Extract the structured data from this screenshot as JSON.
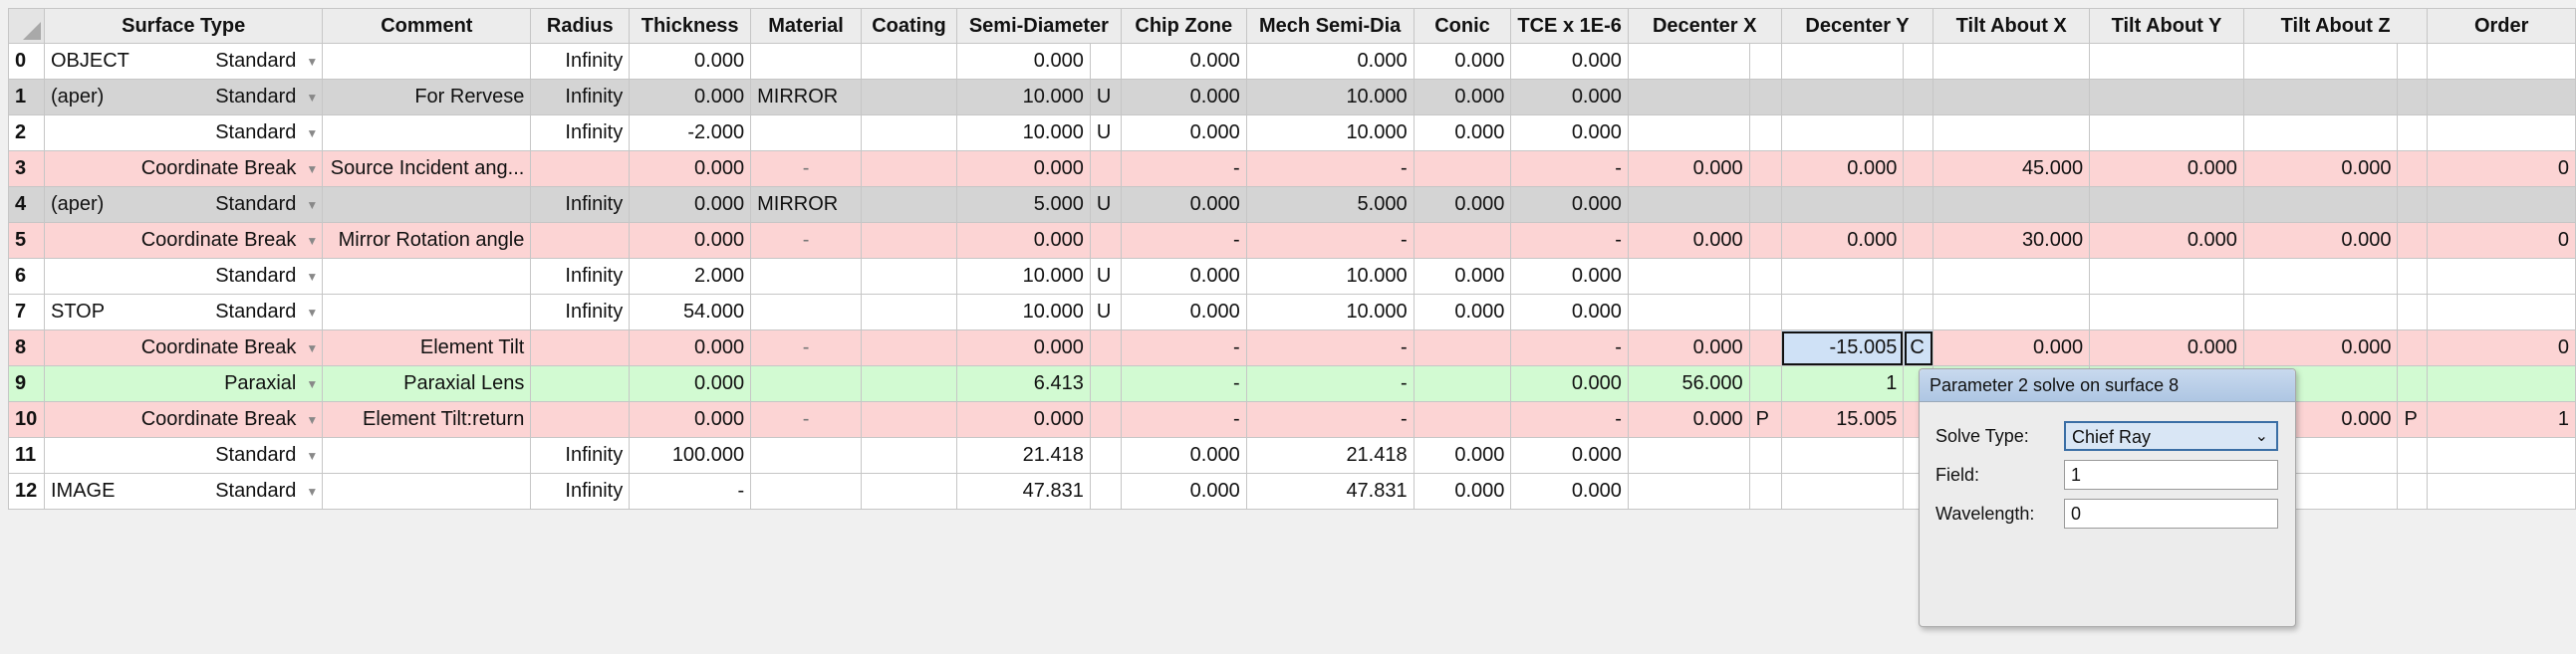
{
  "columns": [
    "Surface Type",
    "Comment",
    "Radius",
    "Thickness",
    "Material",
    "Coating",
    "Semi-Diameter",
    "Chip Zone",
    "Mech Semi-Dia",
    "Conic",
    "TCE x 1E-6",
    "Decenter X",
    "Decenter Y",
    "Tilt About X",
    "Tilt About Y",
    "Tilt About Z",
    "Order"
  ],
  "rows": [
    {
      "num": "0",
      "style": "std",
      "prefix": "OBJECT",
      "type": "Standard",
      "comment": "",
      "radius": "Infinity",
      "thickness": "0.000",
      "material": "",
      "coating": "",
      "semi": "0.000",
      "semi_flag": "",
      "chip": "0.000",
      "mech": "0.000",
      "conic": "0.000",
      "tce": "0.000",
      "dx": "",
      "dx_flag": "",
      "dy": "",
      "dy_flag": "",
      "tx": "",
      "ty": "",
      "tz": "",
      "tz_flag": "",
      "order": ""
    },
    {
      "num": "1",
      "style": "grey",
      "prefix": "(aper)",
      "type": "Standard",
      "comment": "For Rervese",
      "radius": "Infinity",
      "thickness": "0.000",
      "material": "MIRROR",
      "coating": "",
      "semi": "10.000",
      "semi_flag": "U",
      "chip": "0.000",
      "mech": "10.000",
      "conic": "0.000",
      "tce": "0.000",
      "dx": "",
      "dx_flag": "",
      "dy": "",
      "dy_flag": "",
      "tx": "",
      "ty": "",
      "tz": "",
      "tz_flag": "",
      "order": ""
    },
    {
      "num": "2",
      "style": "std",
      "prefix": "",
      "type": "Standard",
      "comment": "",
      "radius": "Infinity",
      "thickness": "-2.000",
      "material": "",
      "coating": "",
      "semi": "10.000",
      "semi_flag": "U",
      "chip": "0.000",
      "mech": "10.000",
      "conic": "0.000",
      "tce": "0.000",
      "dx": "",
      "dx_flag": "",
      "dy": "",
      "dy_flag": "",
      "tx": "",
      "ty": "",
      "tz": "",
      "tz_flag": "",
      "order": ""
    },
    {
      "num": "3",
      "style": "pink",
      "prefix": "",
      "type": "Coordinate Break",
      "comment": "Source Incident ang...",
      "radius": "",
      "thickness": "0.000",
      "material": "-",
      "coating": "",
      "semi": "0.000",
      "semi_flag": "",
      "chip": "-",
      "mech": "-",
      "conic": "",
      "tce": "-",
      "dx": "0.000",
      "dx_flag": "",
      "dy": "0.000",
      "dy_flag": "",
      "tx": "45.000",
      "ty": "0.000",
      "tz": "0.000",
      "tz_flag": "",
      "order": "0"
    },
    {
      "num": "4",
      "style": "grey",
      "prefix": "(aper)",
      "type": "Standard",
      "comment": "",
      "radius": "Infinity",
      "thickness": "0.000",
      "material": "MIRROR",
      "coating": "",
      "semi": "5.000",
      "semi_flag": "U",
      "chip": "0.000",
      "mech": "5.000",
      "conic": "0.000",
      "tce": "0.000",
      "dx": "",
      "dx_flag": "",
      "dy": "",
      "dy_flag": "",
      "tx": "",
      "ty": "",
      "tz": "",
      "tz_flag": "",
      "order": ""
    },
    {
      "num": "5",
      "style": "pink",
      "prefix": "",
      "type": "Coordinate Break",
      "comment": "Mirror Rotation angle",
      "radius": "",
      "thickness": "0.000",
      "material": "-",
      "coating": "",
      "semi": "0.000",
      "semi_flag": "",
      "chip": "-",
      "mech": "-",
      "conic": "",
      "tce": "-",
      "dx": "0.000",
      "dx_flag": "",
      "dy": "0.000",
      "dy_flag": "",
      "tx": "30.000",
      "ty": "0.000",
      "tz": "0.000",
      "tz_flag": "",
      "order": "0"
    },
    {
      "num": "6",
      "style": "std",
      "prefix": "",
      "type": "Standard",
      "comment": "",
      "radius": "Infinity",
      "thickness": "2.000",
      "material": "",
      "coating": "",
      "semi": "10.000",
      "semi_flag": "U",
      "chip": "0.000",
      "mech": "10.000",
      "conic": "0.000",
      "tce": "0.000",
      "dx": "",
      "dx_flag": "",
      "dy": "",
      "dy_flag": "",
      "tx": "",
      "ty": "",
      "tz": "",
      "tz_flag": "",
      "order": ""
    },
    {
      "num": "7",
      "style": "std",
      "prefix": "STOP",
      "type": "Standard",
      "comment": "",
      "radius": "Infinity",
      "thickness": "54.000",
      "material": "",
      "coating": "",
      "semi": "10.000",
      "semi_flag": "U",
      "chip": "0.000",
      "mech": "10.000",
      "conic": "0.000",
      "tce": "0.000",
      "dx": "",
      "dx_flag": "",
      "dy": "",
      "dy_flag": "",
      "tx": "",
      "ty": "",
      "tz": "",
      "tz_flag": "",
      "order": ""
    },
    {
      "num": "8",
      "style": "pink",
      "prefix": "",
      "type": "Coordinate Break",
      "comment": "Element Tilt",
      "radius": "",
      "thickness": "0.000",
      "material": "-",
      "coating": "",
      "semi": "0.000",
      "semi_flag": "",
      "chip": "-",
      "mech": "-",
      "conic": "",
      "tce": "-",
      "dx": "0.000",
      "dx_flag": "",
      "dy": "-15.005",
      "dy_flag": "C",
      "tx": "0.000",
      "ty": "0.000",
      "tz": "0.000",
      "tz_flag": "",
      "order": "0"
    },
    {
      "num": "9",
      "style": "green",
      "prefix": "",
      "type": "Paraxial",
      "comment": "Paraxial Lens",
      "radius": "",
      "thickness": "0.000",
      "material": "",
      "coating": "",
      "semi": "6.413",
      "semi_flag": "",
      "chip": "-",
      "mech": "-",
      "conic": "",
      "tce": "0.000",
      "dx": "56.000",
      "dx_flag": "",
      "dy": "1",
      "dy_flag": "",
      "tx": "",
      "ty": "",
      "tz": "",
      "tz_flag": "",
      "order": ""
    },
    {
      "num": "10",
      "style": "pink",
      "prefix": "",
      "type": "Coordinate Break",
      "comment": "Element Tilt:return",
      "radius": "",
      "thickness": "0.000",
      "material": "-",
      "coating": "",
      "semi": "0.000",
      "semi_flag": "",
      "chip": "-",
      "mech": "-",
      "conic": "",
      "tce": "-",
      "dx": "0.000",
      "dx_flag": "P",
      "dy": "15.005",
      "dy_flag": "",
      "tx": "",
      "ty": "",
      "tz": "0.000",
      "tz_flag": "P",
      "order": "1"
    },
    {
      "num": "11",
      "style": "std",
      "prefix": "",
      "type": "Standard",
      "comment": "",
      "radius": "Infinity",
      "thickness": "100.000",
      "material": "",
      "coating": "",
      "semi": "21.418",
      "semi_flag": "",
      "chip": "0.000",
      "mech": "21.418",
      "conic": "0.000",
      "tce": "0.000",
      "dx": "",
      "dx_flag": "",
      "dy": "",
      "dy_flag": "",
      "tx": "",
      "ty": "",
      "tz": "",
      "tz_flag": "",
      "order": ""
    },
    {
      "num": "12",
      "style": "std",
      "prefix": "IMAGE",
      "type": "Standard",
      "comment": "",
      "radius": "Infinity",
      "thickness": "-",
      "material": "",
      "coating": "",
      "semi": "47.831",
      "semi_flag": "",
      "chip": "0.000",
      "mech": "47.831",
      "conic": "0.000",
      "tce": "0.000",
      "dx": "",
      "dx_flag": "",
      "dy": "",
      "dy_flag": "",
      "tx": "",
      "ty": "",
      "tz": "",
      "tz_flag": "",
      "order": ""
    }
  ],
  "popup": {
    "title": "Parameter 2 solve on surface 8",
    "solve_type_label": "Solve Type:",
    "solve_type_value": "Chief Ray",
    "field_label": "Field:",
    "field_value": "1",
    "wavelength_label": "Wavelength:",
    "wavelength_value": "0"
  },
  "colors": {
    "standard_row": "#ffffff",
    "aperture_row": "#d4d4d4",
    "coordinate_break_row": "#fcd4d4",
    "paraxial_row": "#d2fad2",
    "selected_cell": "#cfe1f6"
  },
  "icons": {
    "surface_type_dropdown": "triangle-down-icon",
    "solve_type_dropdown": "chevron-down-icon"
  }
}
